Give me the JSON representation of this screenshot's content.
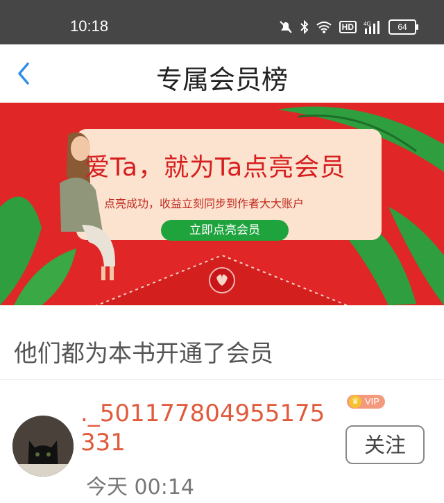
{
  "status_bar": {
    "time": "10:18",
    "hd": "HD",
    "network": "4G",
    "battery": "64"
  },
  "header": {
    "title": "专属会员榜"
  },
  "banner": {
    "headline": "爱Ta，就为Ta点亮会员",
    "subtitle": "点亮成功，收益立刻同步到作者大大账户",
    "button_label": "立即点亮会员"
  },
  "section": {
    "title": "他们都为本书开通了会员"
  },
  "members": [
    {
      "name": "._501177804955175331",
      "badge": "VIP",
      "time": "今天 00:14",
      "follow_label": "关注"
    }
  ],
  "colors": {
    "accent": "#e05a3c",
    "banner_red": "#e02626",
    "button_green": "#1fa33d"
  }
}
